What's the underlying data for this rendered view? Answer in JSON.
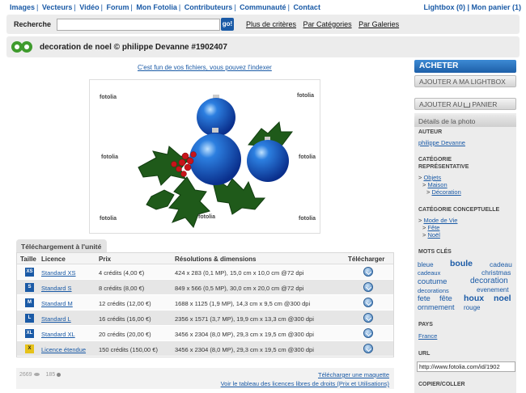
{
  "topnav": {
    "items": [
      "Images",
      "Vecteurs",
      "Vidéo",
      "Forum",
      "Mon Fotolia",
      "Contributeurs",
      "Communauté",
      "Contact"
    ],
    "lightbox": "Lightbox (0)",
    "cart": "Mon panier (1)"
  },
  "search": {
    "label": "Recherche",
    "value": "",
    "go": "go!",
    "links": [
      "Plus de critères",
      "Par Catégories",
      "Par Galeries"
    ]
  },
  "header": {
    "title": "decoration de noel © philippe Devanne #1902407"
  },
  "main": {
    "index_link": "C'est fun de vos fichiers, vous pouvez l'indexer",
    "watermark": "fotolia"
  },
  "download": {
    "tab": "Téléchargement à l'unité",
    "columns": [
      "Taille",
      "Licence",
      "Prix",
      "Résolutions & dimensions",
      "Télécharger"
    ],
    "rows": [
      {
        "size": "XS",
        "licence": "Standard XS",
        "price": "4 crédits (4,00 €)",
        "res": "424 x 283 (0,1 MP), 15,0 cm x 10,0 cm @72 dpi"
      },
      {
        "size": "S",
        "licence": "Standard S",
        "price": "8 crédits (8,00 €)",
        "res": "849 x 566 (0,5 MP), 30,0 cm x 20,0 cm @72 dpi"
      },
      {
        "size": "M",
        "licence": "Standard M",
        "price": "12 crédits (12,00 €)",
        "res": "1688 x 1125 (1,9 MP), 14,3 cm x 9,5 cm @300 dpi"
      },
      {
        "size": "L",
        "licence": "Standard L",
        "price": "16 crédits (16,00 €)",
        "res": "2356 x 1571 (3,7 MP), 19,9 cm x 13,3 cm @300 dpi"
      },
      {
        "size": "XL",
        "licence": "Standard XL",
        "price": "20 crédits (20,00 €)",
        "res": "3456 x 2304 (8,0 MP), 29,3 cm x 19,5 cm @300 dpi"
      },
      {
        "size": "X",
        "licence": "Licence étendue",
        "price": "150 crédits (150,00 €)",
        "res": "3456 x 2304 (8,0 MP), 29,3 cm x 19,5 cm @300 dpi"
      }
    ],
    "views": "2669",
    "downloads": "185",
    "maquette": "Télécharger une maquette",
    "licences_link": "Voir le tableau des licences libres de droits (Prix et Utilisations)"
  },
  "sidebar": {
    "buy": "ACHETER",
    "add_lightbox": "AJOUTER A MA LIGHTBOX",
    "add_cart_prefix": "AJOUTER AU",
    "add_cart_suffix": "PANIER",
    "details_tab": "Détails de la photo",
    "author_h": "AUTEUR",
    "author": "philippe Devanne",
    "cat_rep_h1": "CATÉGORIE",
    "cat_rep_h2": "REPRÉSENTATIVE",
    "cat_rep": [
      "Objets",
      "Maison",
      "Décoration"
    ],
    "cat_con_h": "CATÉGORIE CONCEPTUELLE",
    "cat_con": [
      "Mode de Vie",
      "Fête",
      "Noël"
    ],
    "keywords_h": "MOTS CLÉS",
    "keywords": [
      "bleue",
      "boule",
      "cadeau",
      "cadeaux",
      "christmas",
      "coutume",
      "decoration",
      "decorations",
      "evenement",
      "fete",
      "fête",
      "houx",
      "noel",
      "ornmement",
      "rouge"
    ],
    "pays_h": "PAYS",
    "pays": "France",
    "url_h": "URL",
    "url": "http://www.fotolia.com/id/1902",
    "copier_h": "COPIER/COLLER"
  },
  "colors": {
    "brand_blue": "#1a5aa6",
    "logo_green": "#3f9b2d",
    "panel_gray": "#ececec"
  }
}
